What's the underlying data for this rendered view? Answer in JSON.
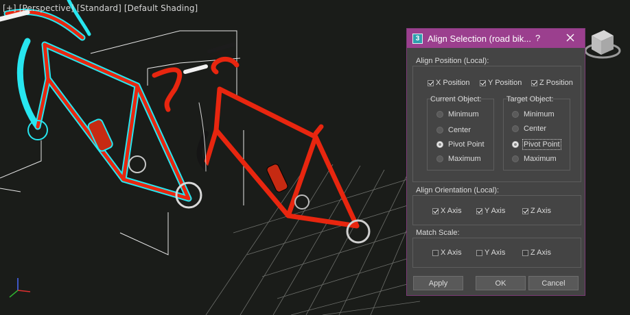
{
  "viewport": {
    "labels": [
      "[+]",
      "[Perspective]",
      "[Standard]",
      "[Default Shading]"
    ]
  },
  "dialog": {
    "title": "Align Selection (road bik...",
    "help_label": "?",
    "align_position": {
      "label": "Align Position (Local):",
      "checkboxes": [
        {
          "label": "X Position",
          "checked": true
        },
        {
          "label": "Y Position",
          "checked": true
        },
        {
          "label": "Z Position",
          "checked": true
        }
      ],
      "current_object": {
        "label": "Current Object:",
        "options": [
          "Minimum",
          "Center",
          "Pivot Point",
          "Maximum"
        ],
        "selected": "Pivot Point"
      },
      "target_object": {
        "label": "Target Object:",
        "options": [
          "Minimum",
          "Center",
          "Pivot Point",
          "Maximum"
        ],
        "selected": "Pivot Point"
      }
    },
    "align_orientation": {
      "label": "Align Orientation (Local):",
      "checkboxes": [
        {
          "label": "X Axis",
          "checked": true
        },
        {
          "label": "Y Axis",
          "checked": true
        },
        {
          "label": "Z Axis",
          "checked": true
        }
      ]
    },
    "match_scale": {
      "label": "Match Scale:",
      "checkboxes": [
        {
          "label": "X Axis",
          "checked": false
        },
        {
          "label": "Y Axis",
          "checked": false
        },
        {
          "label": "Z Axis",
          "checked": false
        }
      ]
    },
    "buttons": {
      "apply": "Apply",
      "ok": "OK",
      "cancel": "Cancel"
    }
  },
  "colors": {
    "titlebar": "#9b3f8e",
    "dialog_bg": "#444444",
    "viewport_bg": "#1a1c19",
    "bike_frame": "#e8260f",
    "selection_outline": "#27e6f0"
  },
  "icons": {
    "app": "3ds-max-app-icon",
    "close": "close-icon",
    "viewcube": "viewcube-icon",
    "axis": "axis-tripod-icon"
  }
}
